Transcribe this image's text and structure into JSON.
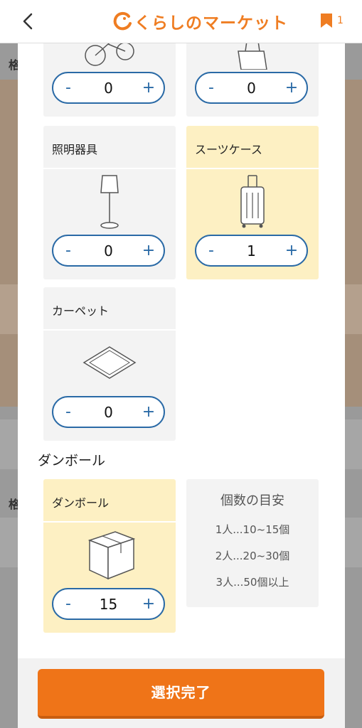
{
  "header": {
    "logo_text": "くらしのマーケット",
    "bookmark_count": "1"
  },
  "background": {
    "text1": "格",
    "text2": "格"
  },
  "cards": [
    {
      "title": "",
      "value": "0",
      "minus": "-",
      "plus": "+",
      "icon": "bicycle-icon",
      "selected": false
    },
    {
      "title": "",
      "value": "0",
      "minus": "-",
      "plus": "+",
      "icon": "bag-icon",
      "selected": false
    },
    {
      "title": "照明器具",
      "value": "0",
      "minus": "-",
      "plus": "+",
      "icon": "lamp-icon",
      "selected": false
    },
    {
      "title": "スーツケース",
      "value": "1",
      "minus": "-",
      "plus": "+",
      "icon": "suitcase-icon",
      "selected": true
    },
    {
      "title": "カーペット",
      "value": "0",
      "minus": "-",
      "plus": "+",
      "icon": "carpet-icon",
      "selected": false
    }
  ],
  "cardboard_section": {
    "title": "ダンボール",
    "card": {
      "title": "ダンボール",
      "value": "15",
      "minus": "-",
      "plus": "+",
      "icon": "cardboard-box-icon",
      "selected": true
    },
    "guide": {
      "title": "個数の目安",
      "lines": [
        "1人...10~15個",
        "2人...20~30個",
        "3人...50個以上"
      ]
    }
  },
  "confirm_label": "選択完了",
  "colors": {
    "accent": "#ef7418",
    "stepper": "#2a6aa6",
    "selected_bg": "#fdf0c3"
  }
}
